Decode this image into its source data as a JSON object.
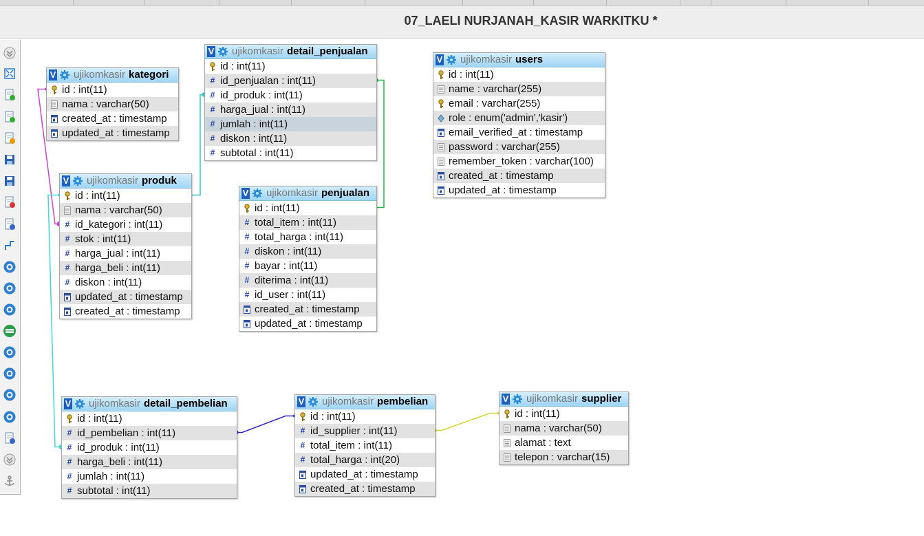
{
  "window": {
    "title": "07_LAELI NURJANAH_KASIR WARKITKU *"
  },
  "toolbar": {
    "items": [
      "toggle-menu-icon",
      "fit-screen-icon",
      "add-table-icon",
      "new-page-icon",
      "edit-page-icon",
      "save-icon",
      "save-as-icon",
      "delete-page-icon",
      "export-icon",
      "angular-links-icon",
      "zoom-icon",
      "refresh-icon",
      "help-icon",
      "toggle-relations-icon",
      "full-screen-icon",
      "reset-icon",
      "small-big-icon",
      "toggle-all-icon",
      "import-icon",
      "collapse-icon",
      "anchor-icon"
    ]
  },
  "tables": [
    {
      "id": "kategori",
      "db": "ujikomkasir",
      "name": "kategori",
      "columns": [
        {
          "text": "id : int(11)",
          "icon": "key"
        },
        {
          "text": "nama : varchar(50)",
          "icon": "text"
        },
        {
          "text": "created_at : timestamp",
          "icon": "date"
        },
        {
          "text": "updated_at : timestamp",
          "icon": "date"
        }
      ]
    },
    {
      "id": "produk",
      "db": "ujikomkasir",
      "name": "produk",
      "columns": [
        {
          "text": "id : int(11)",
          "icon": "key"
        },
        {
          "text": "nama : varchar(50)",
          "icon": "text"
        },
        {
          "text": "id_kategori : int(11)",
          "icon": "number"
        },
        {
          "text": "stok : int(11)",
          "icon": "number"
        },
        {
          "text": "harga_jual : int(11)",
          "icon": "number"
        },
        {
          "text": "harga_beli : int(11)",
          "icon": "number"
        },
        {
          "text": "diskon : int(11)",
          "icon": "number"
        },
        {
          "text": "updated_at : timestamp",
          "icon": "date"
        },
        {
          "text": "created_at : timestamp",
          "icon": "date"
        }
      ]
    },
    {
      "id": "detail_penjualan",
      "db": "ujikomkasir",
      "name": "detail_penjualan",
      "columns": [
        {
          "text": "id : int(11)",
          "icon": "key"
        },
        {
          "text": "id_penjualan : int(11)",
          "icon": "number"
        },
        {
          "text": "id_produk : int(11)",
          "icon": "number"
        },
        {
          "text": "harga_jual : int(11)",
          "icon": "number"
        },
        {
          "text": "jumlah : int(11)",
          "icon": "number"
        },
        {
          "text": "diskon : int(11)",
          "icon": "number"
        },
        {
          "text": "subtotal : int(11)",
          "icon": "number"
        }
      ]
    },
    {
      "id": "penjualan",
      "db": "ujikomkasir",
      "name": "penjualan",
      "columns": [
        {
          "text": "id : int(11)",
          "icon": "key"
        },
        {
          "text": "total_item : int(11)",
          "icon": "number"
        },
        {
          "text": "total_harga : int(11)",
          "icon": "number"
        },
        {
          "text": "diskon : int(11)",
          "icon": "number"
        },
        {
          "text": "bayar : int(11)",
          "icon": "number"
        },
        {
          "text": "diterima : int(11)",
          "icon": "number"
        },
        {
          "text": "id_user : int(11)",
          "icon": "number"
        },
        {
          "text": "created_at : timestamp",
          "icon": "date"
        },
        {
          "text": "updated_at : timestamp",
          "icon": "date"
        }
      ]
    },
    {
      "id": "users",
      "db": "ujikomkasir",
      "name": "users",
      "columns": [
        {
          "text": "id : int(11)",
          "icon": "key"
        },
        {
          "text": "name : varchar(255)",
          "icon": "text"
        },
        {
          "text": "email : varchar(255)",
          "icon": "key"
        },
        {
          "text": "role : enum('admin','kasir')",
          "icon": "enum"
        },
        {
          "text": "email_verified_at : timestamp",
          "icon": "date"
        },
        {
          "text": "password : varchar(255)",
          "icon": "text"
        },
        {
          "text": "remember_token : varchar(100)",
          "icon": "text"
        },
        {
          "text": "created_at : timestamp",
          "icon": "date"
        },
        {
          "text": "updated_at : timestamp",
          "icon": "date"
        }
      ]
    },
    {
      "id": "detail_pembelian",
      "db": "ujikomkasir",
      "name": "detail_pembelian",
      "columns": [
        {
          "text": "id : int(11)",
          "icon": "key"
        },
        {
          "text": "id_pembelian : int(11)",
          "icon": "number"
        },
        {
          "text": "id_produk : int(11)",
          "icon": "number"
        },
        {
          "text": "harga_beli : int(11)",
          "icon": "number"
        },
        {
          "text": "jumlah : int(11)",
          "icon": "number"
        },
        {
          "text": "subtotal : int(11)",
          "icon": "number"
        }
      ]
    },
    {
      "id": "pembelian",
      "db": "ujikomkasir",
      "name": "pembelian",
      "columns": [
        {
          "text": "id : int(11)",
          "icon": "key"
        },
        {
          "text": "id_supplier : int(11)",
          "icon": "number"
        },
        {
          "text": "total_item : int(11)",
          "icon": "number"
        },
        {
          "text": "total_harga : int(20)",
          "icon": "number"
        },
        {
          "text": "updated_at : timestamp",
          "icon": "date"
        },
        {
          "text": "created_at : timestamp",
          "icon": "date"
        }
      ]
    },
    {
      "id": "supplier",
      "db": "ujikomkasir",
      "name": "supplier",
      "columns": [
        {
          "text": "id : int(11)",
          "icon": "key"
        },
        {
          "text": "nama : varchar(50)",
          "icon": "text"
        },
        {
          "text": "alamat : text",
          "icon": "text"
        },
        {
          "text": "telepon : varchar(15)",
          "icon": "text"
        }
      ]
    }
  ],
  "relations": [
    {
      "from": "produk.id_kategori",
      "to": "kategori.id",
      "color": "#cc44cc"
    },
    {
      "from": "detail_penjualan.id_produk",
      "to": "produk.id",
      "color": "#33c6c6"
    },
    {
      "from": "detail_penjualan.id_penjualan",
      "to": "penjualan.id",
      "color": "#22bb44"
    },
    {
      "from": "detail_pembelian.id_produk",
      "to": "produk.id",
      "color": "#44d6d6"
    },
    {
      "from": "detail_pembelian.id_pembelian",
      "to": "pembelian.id",
      "color": "#2a2ab8"
    },
    {
      "from": "pembelian.id_supplier",
      "to": "supplier.id",
      "color": "#d4d433"
    }
  ]
}
